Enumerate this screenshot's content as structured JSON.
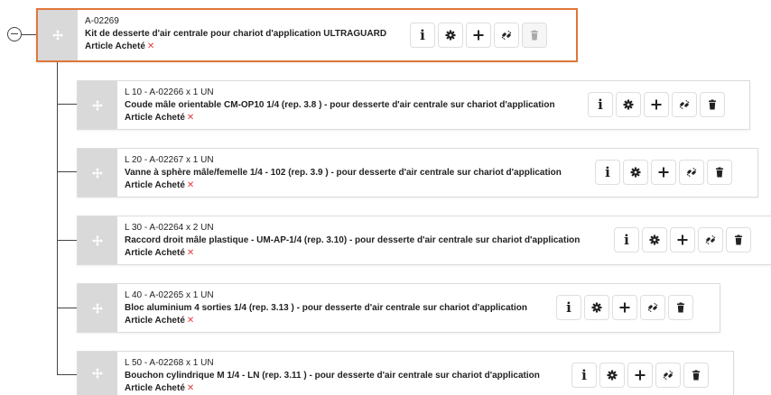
{
  "root": {
    "code": "A-02269",
    "description": "Kit de desserte d'air centrale pour chariot d'application ULTRAGUARD",
    "type_label": "Article Acheté",
    "type_mark": "✕"
  },
  "children": [
    {
      "line": "L 10 - A-02266 x 1 UN",
      "description": "Coude mâle orientable CM-OP10 1/4 (rep. 3.8 ) - pour desserte d'air centrale sur chariot d'application",
      "type_label": "Article Acheté",
      "type_mark": "✕"
    },
    {
      "line": "L 20 - A-02267 x 1 UN",
      "description": "Vanne à sphère mâle/femelle 1/4 - 102 (rep. 3.9 ) - pour desserte d'air centrale sur chariot d'application",
      "type_label": "Article Acheté",
      "type_mark": "✕"
    },
    {
      "line": "L 30 - A-02264 x 2 UN",
      "description": "Raccord droit mâle plastique - UM-AP-1/4 (rep. 3.10) - pour desserte d'air centrale sur chariot d'application",
      "type_label": "Article Acheté",
      "type_mark": "✕"
    },
    {
      "line": "L 40 - A-02265 x 1 UN",
      "description": "Bloc aluminium 4 sorties 1/4 (rep. 3.13 ) - pour desserte d'air centrale sur chariot d'application",
      "type_label": "Article Acheté",
      "type_mark": "✕"
    },
    {
      "line": "L 50 - A-02268 x 1 UN",
      "description": "Bouchon cylindrique M 1/4 - LN (rep. 3.11 ) - pour desserte d'air centrale sur chariot d'application",
      "type_label": "Article Acheté",
      "type_mark": "✕"
    }
  ],
  "actions": {
    "info_glyph": "i",
    "icons": [
      "info-icon",
      "gear-icon",
      "plus-icon",
      "unlink-icon",
      "trash-icon"
    ]
  },
  "colors": {
    "root_border": "#e0763a",
    "drag_handle_bg": "#d9d9d9",
    "x_mark": "#e23c3c"
  }
}
